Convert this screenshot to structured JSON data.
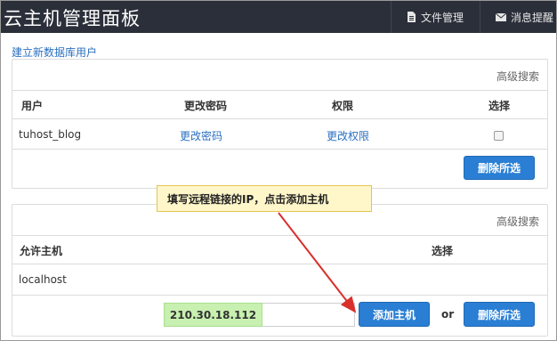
{
  "header": {
    "title": "云主机管理面板",
    "nav": [
      {
        "icon": "document-icon",
        "label": "文件管理"
      },
      {
        "icon": "envelope-icon",
        "label": "消息提醒"
      }
    ]
  },
  "create_db_user_link": "建立新数据库用户",
  "users_panel": {
    "advanced_search": "高级搜索",
    "columns": [
      "用户",
      "更改密码",
      "权限",
      "选择"
    ],
    "rows": [
      {
        "user": "tuhost_blog",
        "change_password": "更改密码",
        "permissions": "更改权限"
      }
    ],
    "delete_button": "删除所选"
  },
  "hosts_panel": {
    "advanced_search": "高级搜索",
    "columns": [
      "允许主机",
      "选择"
    ],
    "rows": [
      {
        "host": "localhost"
      }
    ],
    "ip_input_value": "210.30.18.112",
    "add_host_button": "添加主机",
    "or_label": "or",
    "delete_button": "删除所选"
  },
  "annotation": {
    "text": "填写远程链接的IP，点击添加主机"
  },
  "colors": {
    "topbar": "#2b2f3a",
    "link": "#2a6fbf",
    "button": "#2a7fd4",
    "highlight": "#c8f0b0",
    "callout": "#fff6c9",
    "arrow": "#d9302c"
  }
}
